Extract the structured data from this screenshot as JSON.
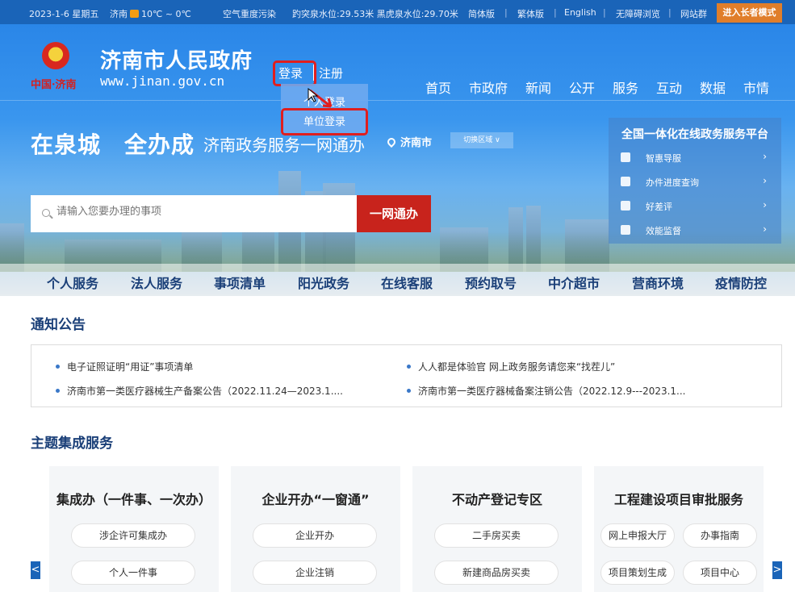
{
  "topbar": {
    "date": "2023-1-6 星期五",
    "city": "济南",
    "temp": "10℃ ~ 0℃",
    "air": "空气重度污染",
    "water": "趵突泉水位:29.53米 黑虎泉水位:29.70米",
    "links": [
      "简体版",
      "繁体版",
      "English",
      "无障碍浏览",
      "网站群"
    ],
    "elder_mode": "进入长者模式"
  },
  "header": {
    "emblem_text": "中国·济南",
    "title": "济南市人民政府",
    "url": "www.jinan.gov.cn",
    "login": "登录",
    "register": "注册",
    "dropdown": [
      "个人登录",
      "单位登录"
    ],
    "nav": [
      "首页",
      "市政府",
      "新闻",
      "公开",
      "服务",
      "互动",
      "数据",
      "市情"
    ]
  },
  "hero": {
    "slogan": "在泉城　全办成",
    "slogan2": "济南政务服务一网通办",
    "location": "济南市",
    "switch_region": "切换区域 ∨",
    "search_placeholder": "请输入您要办理的事项",
    "search_button": "一网通办"
  },
  "side_panel": {
    "title": "全国一体化在线政务服务平台",
    "items": [
      "智惠导服",
      "办件进度查询",
      "好差评",
      "效能监督"
    ]
  },
  "subnav": [
    "个人服务",
    "法人服务",
    "事项清单",
    "阳光政务",
    "在线客服",
    "预约取号",
    "中介超市",
    "营商环境",
    "疫情防控"
  ],
  "notices": {
    "title": "通知公告",
    "items": [
      "电子证照证明“用证”事项清单",
      "人人都是体验官 网上政务服务请您来“找茬儿”",
      "济南市第一类医疗器械生产备案公告（2022.11.24—2023.1....",
      "济南市第一类医疗器械备案注销公告（2022.12.9---2023.1..."
    ]
  },
  "services": {
    "title": "主题集成服务",
    "cards": [
      {
        "title": "集成办（一件事、一次办）",
        "buttons": [
          "涉企许可集成办",
          "个人一件事"
        ]
      },
      {
        "title": "企业开办“一窗通”",
        "buttons": [
          "企业开办",
          "企业注销"
        ]
      },
      {
        "title": "不动产登记专区",
        "buttons": [
          "二手房买卖",
          "新建商品房买卖"
        ]
      },
      {
        "title": "工程建设项目审批服务",
        "buttons": [
          "网上申报大厅",
          "办事指南",
          "项目策划生成",
          "项目中心"
        ]
      }
    ],
    "prev": "<",
    "next": ">"
  },
  "colors": {
    "primary": "#1a64b8",
    "accent_red": "#c8231c",
    "highlight": "#e01e1e",
    "elder_orange": "#e07e2a"
  }
}
